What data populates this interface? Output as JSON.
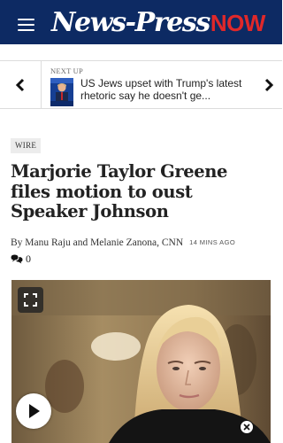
{
  "header": {
    "logo_main": "News-Press",
    "logo_now": "NOW",
    "colors": {
      "background": "#0d2a63",
      "now_red": "#e0282a"
    }
  },
  "next_up": {
    "label": "NEXT UP",
    "title": "US Jews upset with Trump's latest rhetoric say he doesn't ge..."
  },
  "article": {
    "category": "WIRE",
    "headline": "Marjorie Taylor Greene files motion to oust Speaker Johnson",
    "byline": "By Manu Raju and Melanie Zanona, CNN",
    "timestamp": "14 MINS AGO",
    "comment_count": "0"
  },
  "video": {
    "icons": [
      "expand-icon",
      "play-icon",
      "close-icon"
    ]
  }
}
